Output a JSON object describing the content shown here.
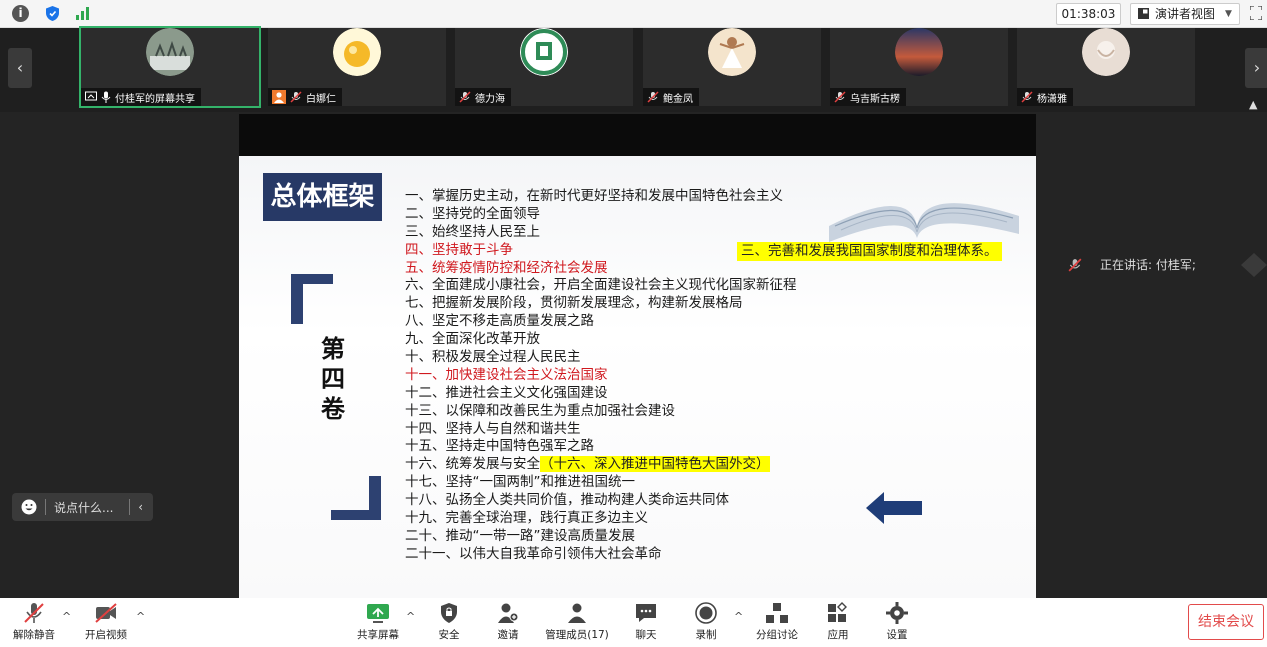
{
  "topbar": {
    "timer": "01:38:03",
    "view_label": "演讲者视图"
  },
  "participants": [
    {
      "name": "付桂军的屏幕共享",
      "avatar_color": "#8b9a8c"
    },
    {
      "name": "白娜仁",
      "avatar_color": "#f5b928"
    },
    {
      "name": "德力海",
      "avatar_color": "#2e8b57"
    },
    {
      "name": "鲍金凤",
      "avatar_color": "#d8a679"
    },
    {
      "name": "乌吉斯古楞",
      "avatar_color": "#3a4a7a"
    },
    {
      "name": "杨潇雅",
      "avatar_color": "#e8ddd4"
    }
  ],
  "slide": {
    "title": "总体框架",
    "volume": [
      "第",
      "四",
      "卷"
    ],
    "highlight_right": "三、完善和发展我国国家制度和治理体系。",
    "items": [
      {
        "text": "一、掌握历史主动，在新时代更好坚持和发展中国特色社会主义",
        "red": false
      },
      {
        "text": "二、坚持党的全面领导",
        "red": false
      },
      {
        "text": "三、始终坚持人民至上",
        "red": false
      },
      {
        "text": "四、坚持敢于斗争",
        "red": true
      },
      {
        "text": "五、统筹疫情防控和经济社会发展",
        "red": true
      },
      {
        "text": "六、全面建成小康社会，开启全面建设社会主义现代化国家新征程",
        "red": false
      },
      {
        "text": "七、把握新发展阶段，贯彻新发展理念，构建新发展格局",
        "red": false
      },
      {
        "text": "八、坚定不移走高质量发展之路",
        "red": false
      },
      {
        "text": "九、全面深化改革开放",
        "red": false
      },
      {
        "text": "十、积极发展全过程人民民主",
        "red": false
      },
      {
        "text": "十一、加快建设社会主义法治国家",
        "red": true
      },
      {
        "text": "十二、推进社会主义文化强国建设",
        "red": false
      },
      {
        "text": "十三、以保障和改善民生为重点加强社会建设",
        "red": false
      },
      {
        "text": "十四、坚持人与自然和谐共生",
        "red": false
      },
      {
        "text": "十五、坚持走中国特色强军之路",
        "red": false
      },
      {
        "text": "十六、统筹发展与安全",
        "red": false,
        "highlight": "（十六、深入推进中国特色大国外交）"
      },
      {
        "text": "十七、坚持“一国两制”和推进祖国统一",
        "red": false
      },
      {
        "text": "十八、弘扬全人类共同价值，推动构建人类命运共同体",
        "red": false
      },
      {
        "text": "十九、完善全球治理，践行真正多边主义",
        "red": false
      },
      {
        "text": "二十、推动“一带一路”建设高质量发展",
        "red": false
      },
      {
        "text": "二十一、以伟大自我革命引领伟大社会革命",
        "red": false
      }
    ]
  },
  "chat_pill": {
    "placeholder": "说点什么..."
  },
  "speaking": {
    "text": "正在讲话: 付桂军;"
  },
  "toolbar": {
    "unmute": "解除静音",
    "start_video": "开启视频",
    "share_screen": "共享屏幕",
    "security": "安全",
    "invite": "邀请",
    "participants": "管理成员(17)",
    "chat": "聊天",
    "record": "录制",
    "breakout": "分组讨论",
    "apps": "应用",
    "settings": "设置",
    "end_meeting": "结束会议"
  },
  "colors": {
    "title_bg": "#273966",
    "red_text": "#d0191f",
    "highlight": "#ffff00",
    "end_button": "#e24b4b",
    "active_tile_border": "#34b36a"
  }
}
